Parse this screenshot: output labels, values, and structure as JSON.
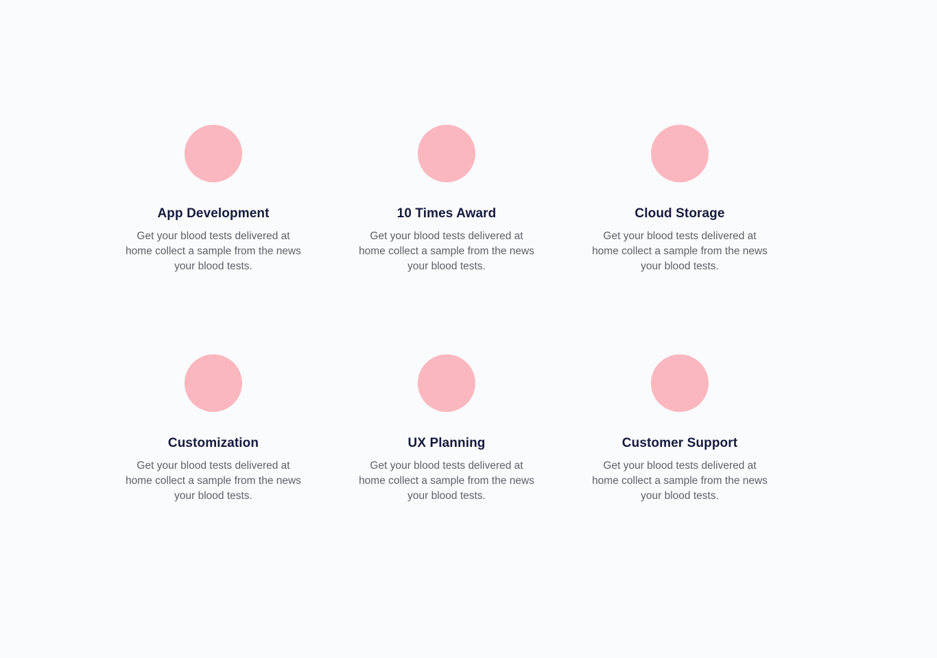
{
  "theme": {
    "page_bg": "#fafbfd",
    "icon_color": "#fbb7bf",
    "title_color": "#161a3d",
    "text_color": "#5f5f68"
  },
  "features": [
    {
      "icon": "pink-circle-icon",
      "title": "App Development",
      "description": "Get your blood tests delivered at home collect a sample from the news your blood tests."
    },
    {
      "icon": "pink-circle-icon",
      "title": "10 Times Award",
      "description": "Get your blood tests delivered at home collect a sample from the news your blood tests."
    },
    {
      "icon": "pink-circle-icon",
      "title": "Cloud Storage",
      "description": "Get your blood tests delivered at home collect a sample from the news your blood tests."
    },
    {
      "icon": "pink-circle-icon",
      "title": "Customization",
      "description": "Get your blood tests delivered at home collect a sample from the news your blood tests."
    },
    {
      "icon": "pink-circle-icon",
      "title": "UX Planning",
      "description": "Get your blood tests delivered at home collect a sample from the news your blood tests."
    },
    {
      "icon": "pink-circle-icon",
      "title": "Customer Support",
      "description": "Get your blood tests delivered at home collect a sample from the news your blood tests."
    }
  ]
}
